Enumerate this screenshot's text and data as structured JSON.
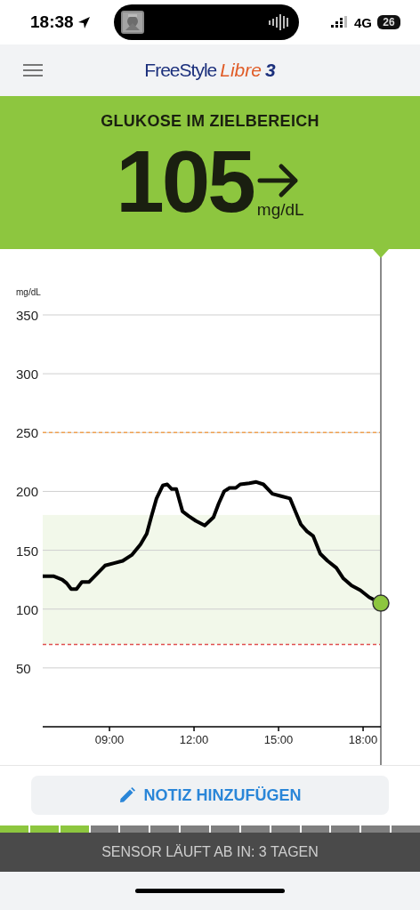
{
  "status_bar": {
    "time": "18:38",
    "network": "4G",
    "battery": "26"
  },
  "header": {
    "brand": "FreeStyle",
    "product": "Libre",
    "version": "3"
  },
  "glucose": {
    "status": "GLUKOSE IM ZIELBEREICH",
    "value": "105",
    "unit": "mg/dL",
    "kind": "steady"
  },
  "chart": {
    "chart_data": {
      "type": "line",
      "ylabel": "mg/dL",
      "xlim": [
        6.63,
        18.63
      ],
      "ylim": [
        0,
        350
      ],
      "xticks": [
        {
          "value": 9,
          "label": "09:00"
        },
        {
          "value": 12,
          "label": "12:00"
        },
        {
          "value": 15,
          "label": "15:00"
        },
        {
          "value": 18,
          "label": "18:00"
        }
      ],
      "yticks": [
        50,
        100,
        150,
        200,
        250,
        300,
        350
      ],
      "x": [
        6.63,
        7.01,
        7.32,
        7.48,
        7.64,
        7.83,
        8.02,
        8.27,
        8.52,
        8.84,
        9.16,
        9.47,
        9.79,
        10.1,
        10.32,
        10.48,
        10.67,
        10.89,
        11.05,
        11.21,
        11.37,
        11.59,
        11.81,
        12.06,
        12.38,
        12.69,
        12.88,
        13.07,
        13.26,
        13.48,
        13.64,
        13.96,
        14.21,
        14.46,
        14.78,
        15.09,
        15.41,
        15.6,
        15.79,
        16.01,
        16.23,
        16.48,
        16.74,
        17.05,
        17.3,
        17.59,
        17.9,
        18.22,
        18.63
      ],
      "grid": true,
      "series": [
        {
          "color": "#000000",
          "values": [
            128,
            128,
            125,
            122,
            117,
            117,
            123,
            123,
            129,
            137,
            139,
            141,
            146,
            155,
            164,
            178,
            194,
            205,
            206,
            202,
            202,
            183,
            179,
            175,
            171,
            178,
            190,
            200,
            203,
            203,
            206,
            207,
            208,
            206,
            198,
            196,
            194,
            183,
            172,
            166,
            162,
            147,
            141,
            135,
            126,
            120,
            116,
            110,
            105
          ]
        }
      ],
      "bands": [
        {
          "axis": "y",
          "from": 70,
          "to": 180,
          "color": "#f2f8ea"
        }
      ],
      "ref_lines": [
        {
          "axis": "y",
          "value": 250,
          "color": "#f0a050"
        },
        {
          "axis": "y",
          "value": 70,
          "color": "#e0504f"
        },
        {
          "axis": "x",
          "value": 18.63,
          "color": "#8a8a8a"
        }
      ]
    }
  },
  "note_button": {
    "label": "NOTIZ HINZUFÜGEN"
  },
  "sensor": {
    "segments": [
      {
        "filled": true
      },
      {
        "filled": true
      },
      {
        "filled": true
      },
      {
        "filled": false
      },
      {
        "filled": false
      },
      {
        "filled": false
      },
      {
        "filled": false
      },
      {
        "filled": false
      },
      {
        "filled": false
      },
      {
        "filled": false
      },
      {
        "filled": false
      },
      {
        "filled": false
      },
      {
        "filled": false
      },
      {
        "filled": false
      }
    ],
    "message": "SENSOR LÄUFT AB IN: 3 TAGEN"
  }
}
